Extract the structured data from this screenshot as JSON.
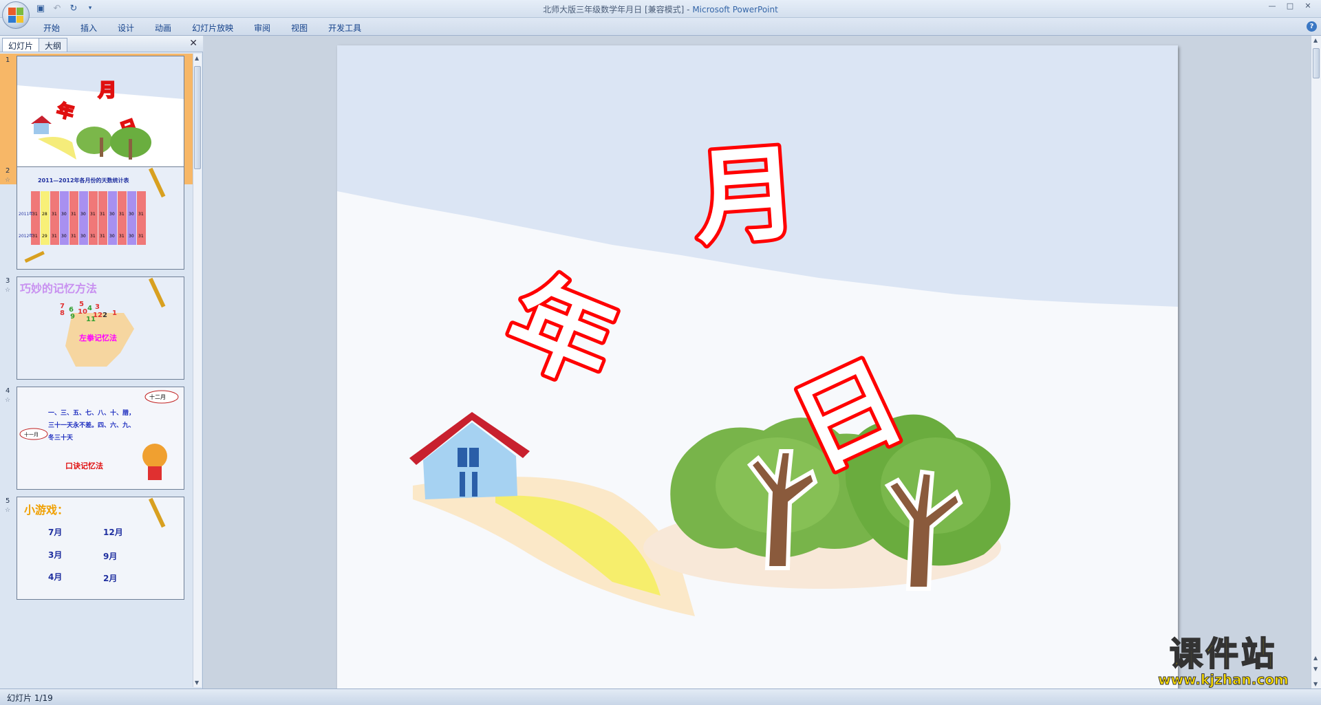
{
  "window": {
    "title": "北师大版三年级数学年月日 [兼容模式]",
    "app_name": "Microsoft PowerPoint",
    "separator": " - "
  },
  "ribbon": {
    "tabs": [
      "开始",
      "插入",
      "设计",
      "动画",
      "幻灯片放映",
      "审阅",
      "视图",
      "开发工具"
    ]
  },
  "left_pane": {
    "tabs": [
      "幻灯片",
      "大纲"
    ],
    "slides": [
      {
        "num": "1",
        "chars": [
          "月",
          "年",
          "日"
        ]
      },
      {
        "num": "2",
        "title": "2011—2012年各月份的天数统计表",
        "row_labels": [
          "2011年",
          "2012年"
        ],
        "row1": [
          "31",
          "28",
          "31",
          "30",
          "31",
          "30",
          "31",
          "31",
          "30",
          "31",
          "30",
          "31"
        ],
        "row2": [
          "31",
          "29",
          "31",
          "30",
          "31",
          "30",
          "31",
          "31",
          "30",
          "31",
          "30",
          "31"
        ]
      },
      {
        "num": "3",
        "title": "巧妙的记忆方法",
        "label": "左拳记忆法",
        "numbers": [
          "7",
          "8",
          "6",
          "9",
          "5",
          "10",
          "4",
          "11",
          "3",
          "12",
          "2",
          "1"
        ]
      },
      {
        "num": "4",
        "bubble1": "十二月",
        "bubble2": "十一月",
        "line1": "一、三、五、七、八、十、腊，",
        "line2": "三十一天永不差。四、六、九、",
        "line3": "冬三十天",
        "label": "口诀记忆法"
      },
      {
        "num": "5",
        "title": "小游戏：",
        "months": [
          "7月",
          "12月",
          "3月",
          "9月",
          "4月",
          "2月"
        ]
      }
    ]
  },
  "slide": {
    "chars": {
      "month": "月",
      "year": "年",
      "day": "日"
    }
  },
  "status": {
    "text": "幻灯片 1/19"
  },
  "watermark": {
    "cn": "课件站",
    "url": "www.kjzhan.com"
  },
  "colors": {
    "accent": "#ff0000",
    "selected_thumb": "#f7b767",
    "sky": "#dbe5f4"
  }
}
